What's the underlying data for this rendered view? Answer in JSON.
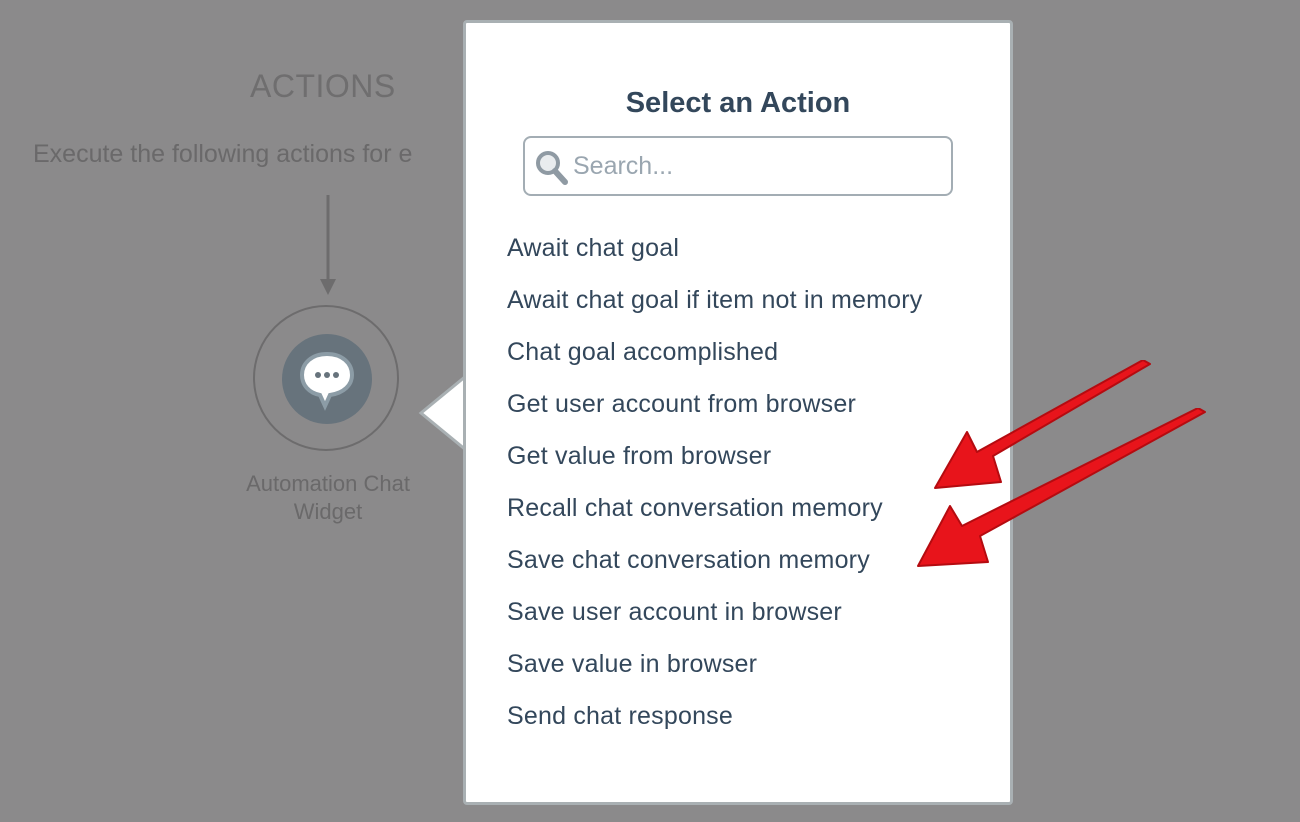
{
  "background": {
    "section_title": "ACTIONS",
    "description": "Execute the following actions for e",
    "node": {
      "icon": "chat-bubble-icon",
      "label_line1": "Automation Chat",
      "label_line2": "Widget"
    }
  },
  "popover": {
    "title": "Select an Action",
    "search": {
      "placeholder": "Search...",
      "value": ""
    },
    "actions": [
      "Await chat goal",
      "Await chat goal if item not in memory",
      "Chat goal accomplished",
      "Get user account from browser",
      "Get value from browser",
      "Recall chat conversation memory",
      "Save chat conversation memory",
      "Save user account in browser",
      "Save value in browser",
      "Send chat response"
    ]
  },
  "annotations": {
    "arrow_color": "#e8141b",
    "arrows": [
      {
        "points_to": "Recall chat conversation memory"
      },
      {
        "points_to": "Save chat conversation memory"
      }
    ]
  },
  "colors": {
    "overlay": "#8b8a8b",
    "text": "#33475b",
    "popover_border": "#a9b0b3",
    "placeholder": "#9aa6b0"
  }
}
